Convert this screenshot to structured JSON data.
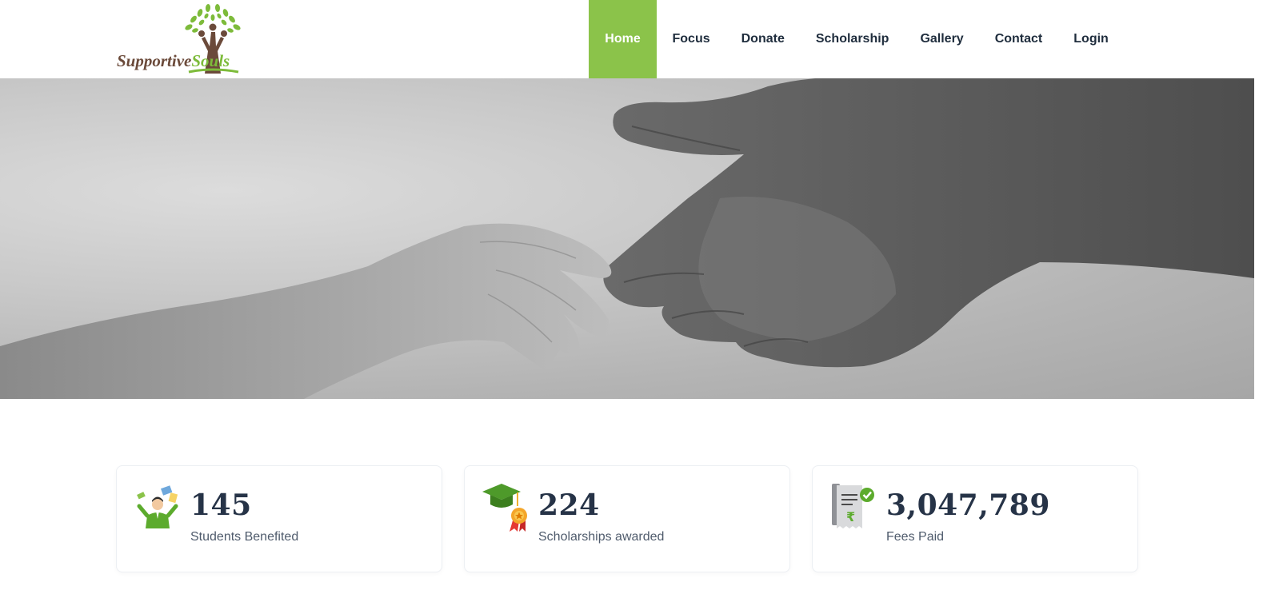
{
  "logo": {
    "word1": "Supportive",
    "word2": "Souls"
  },
  "nav": [
    {
      "label": "Home",
      "active": true
    },
    {
      "label": "Focus"
    },
    {
      "label": "Donate"
    },
    {
      "label": "Scholarship"
    },
    {
      "label": "Gallery"
    },
    {
      "label": "Contact"
    },
    {
      "label": "Login"
    }
  ],
  "hero": {
    "image": "helping-hands-photo"
  },
  "stats": [
    {
      "value": "145",
      "label": "Students Benefited",
      "icon": "student-icon"
    },
    {
      "value": "224",
      "label": "Scholarships awarded",
      "icon": "graduation-cap-award-icon"
    },
    {
      "value": "3,047,789",
      "label": "Fees Paid",
      "icon": "fee-receipt-icon"
    }
  ],
  "colors": {
    "accent": "#8bc34a",
    "text": "#1f2d3d",
    "brand_brown": "#6b4a3a",
    "brand_green": "#7dbb3a"
  }
}
